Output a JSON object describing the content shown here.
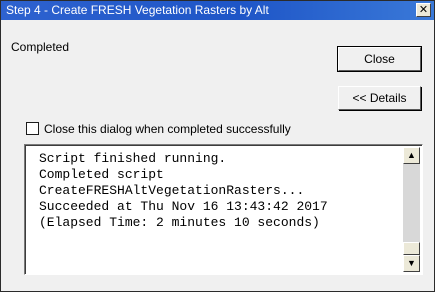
{
  "window": {
    "title": "Step 4 - Create FRESH Vegetation Rasters by Alt",
    "close_glyph": "✕"
  },
  "status_text": "Completed",
  "buttons": {
    "close_label": "Close",
    "details_label": "<< Details"
  },
  "checkbox": {
    "label": "Close this dialog when completed successfully",
    "checked": false
  },
  "log": {
    "lines": [
      "Script finished running.",
      "Completed script",
      "CreateFRESHAltVegetationRasters...",
      "Succeeded at Thu Nov 16 13:43:42 2017",
      "(Elapsed Time: 2 minutes 10 seconds)"
    ]
  },
  "scrollbar": {
    "up_glyph": "▲",
    "down_glyph": "▼"
  }
}
